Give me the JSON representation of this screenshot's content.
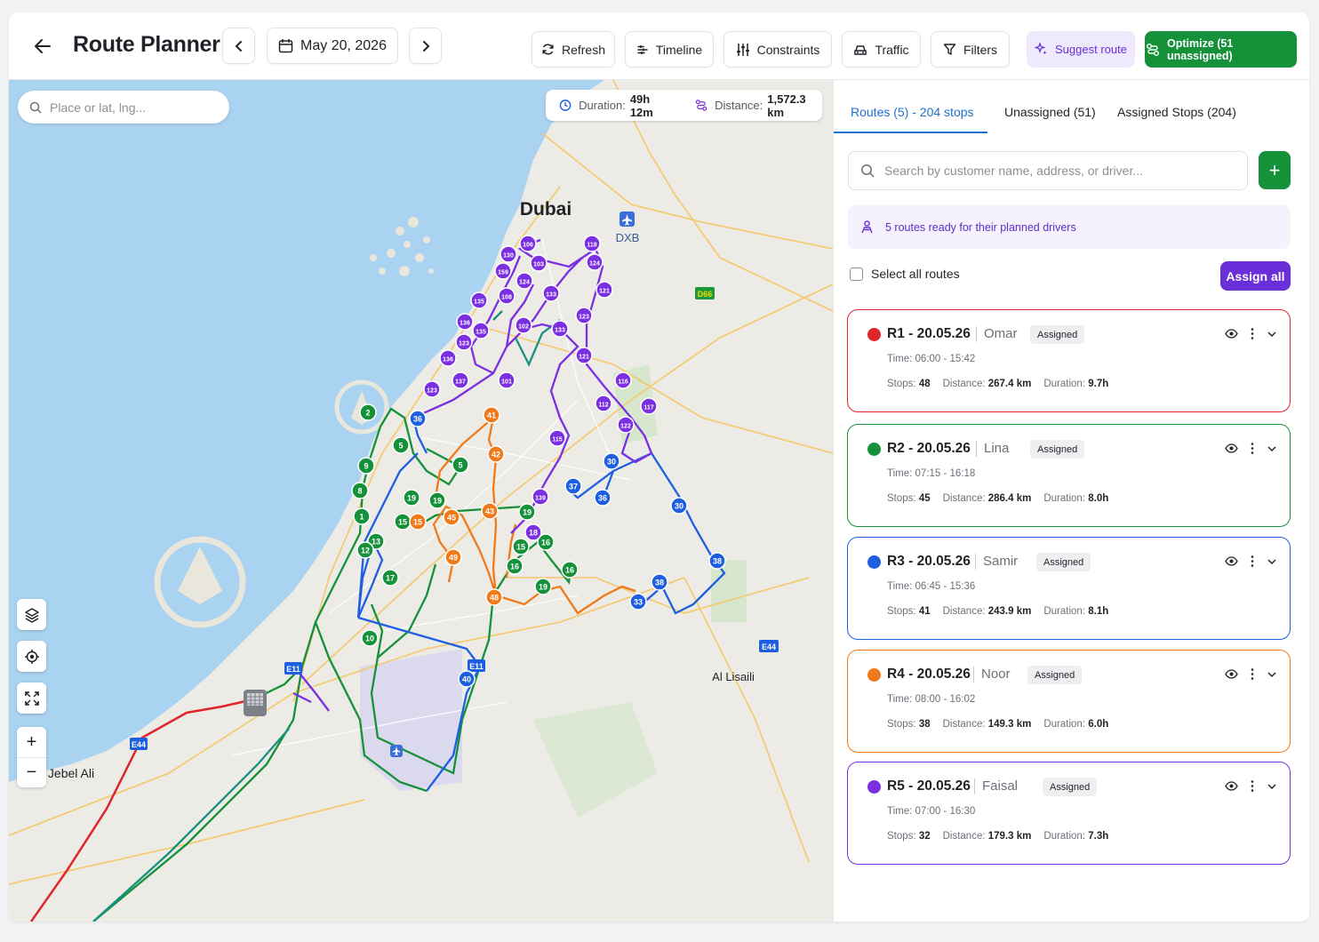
{
  "header": {
    "title": "Route Planner",
    "date": "May 20, 2026",
    "buttons": {
      "refresh": "Refresh",
      "timeline": "Timeline",
      "constraints": "Constraints",
      "traffic": "Traffic",
      "filters": "Filters",
      "suggest": "Suggest route",
      "optimize": "Optimize (51 unassigned)"
    }
  },
  "map": {
    "search_placeholder": "Place or lat, lng...",
    "duration_label": "Duration:",
    "duration_value": "49h 12m",
    "distance_label": "Distance:",
    "distance_value": "1,572.3 km",
    "labels": {
      "city": "Dubai",
      "airport": "DXB",
      "area_east": "Al Lisaili",
      "area_west": "Jebel Ali",
      "road_d66": "D66",
      "road_e44": "E44",
      "road_e11": "E11",
      "road_e11b": "E11",
      "road_e44b": "E44"
    },
    "markers": {
      "r1": [],
      "r2": [
        "2",
        "9",
        "8",
        "1",
        "13",
        "12",
        "17",
        "10",
        "5",
        "5",
        "19",
        "19",
        "15",
        "19",
        "15",
        "16",
        "16",
        "19",
        "16"
      ],
      "r3": [
        "36",
        "30",
        "37",
        "36",
        "30",
        "38",
        "38",
        "33",
        "40"
      ],
      "r4": [
        "41",
        "42",
        "45",
        "15",
        "43",
        "49",
        "48"
      ],
      "r5": [
        "106",
        "118",
        "130",
        "103",
        "124",
        "159",
        "124",
        "121",
        "133",
        "135",
        "108",
        "123",
        "102",
        "136",
        "135",
        "123",
        "133",
        "121",
        "136",
        "137",
        "101",
        "116",
        "123",
        "112",
        "117",
        "122",
        "115",
        "139",
        "18"
      ]
    },
    "controls": {
      "zoom_in": "+",
      "zoom_out": "−"
    }
  },
  "panel": {
    "tabs": [
      "Routes (5) - 204 stops",
      "Unassigned (51)",
      "Assigned Stops (204)"
    ],
    "search_placeholder": "Search by customer name, address, or driver...",
    "add_label": "+",
    "ready_banner": "5 routes ready for their planned drivers",
    "select_all": "Select all routes",
    "assign_all": "Assign all",
    "labels": {
      "time": "Time:",
      "stops": "Stops:",
      "distance": "Distance:",
      "duration": "Duration:"
    },
    "routes": [
      {
        "name": "R1 - 20.05.26",
        "driver": "Omar",
        "status": "Assigned",
        "time": "06:00 - 15:42",
        "stops": "48",
        "distance": "267.4 km",
        "duration": "9.7h",
        "color": "#e0242b"
      },
      {
        "name": "R2 - 20.05.26",
        "driver": "Lina",
        "status": "Assigned",
        "time": "07:15 - 16:18",
        "stops": "45",
        "distance": "286.4 km",
        "duration": "8.0h",
        "color": "#15913a"
      },
      {
        "name": "R3 - 20.05.26",
        "driver": "Samir",
        "status": "Assigned",
        "time": "06:45 - 15:36",
        "stops": "41",
        "distance": "243.9 km",
        "duration": "8.1h",
        "color": "#1d5fe0"
      },
      {
        "name": "R4 - 20.05.26",
        "driver": "Noor",
        "status": "Assigned",
        "time": "08:00 - 16:02",
        "stops": "38",
        "distance": "149.3 km",
        "duration": "6.0h",
        "color": "#f07a1a"
      },
      {
        "name": "R5 - 20.05.26",
        "driver": "Faisal",
        "status": "Assigned",
        "time": "07:00 - 16:30",
        "stops": "32",
        "distance": "179.3 km",
        "duration": "7.3h",
        "color": "#7a2fe0"
      }
    ]
  },
  "colors": {
    "primary_green": "#15913a",
    "accent_purple": "#6a2fd8",
    "active_tab_blue": "#1f6fd1",
    "water": "#aad3f2"
  }
}
